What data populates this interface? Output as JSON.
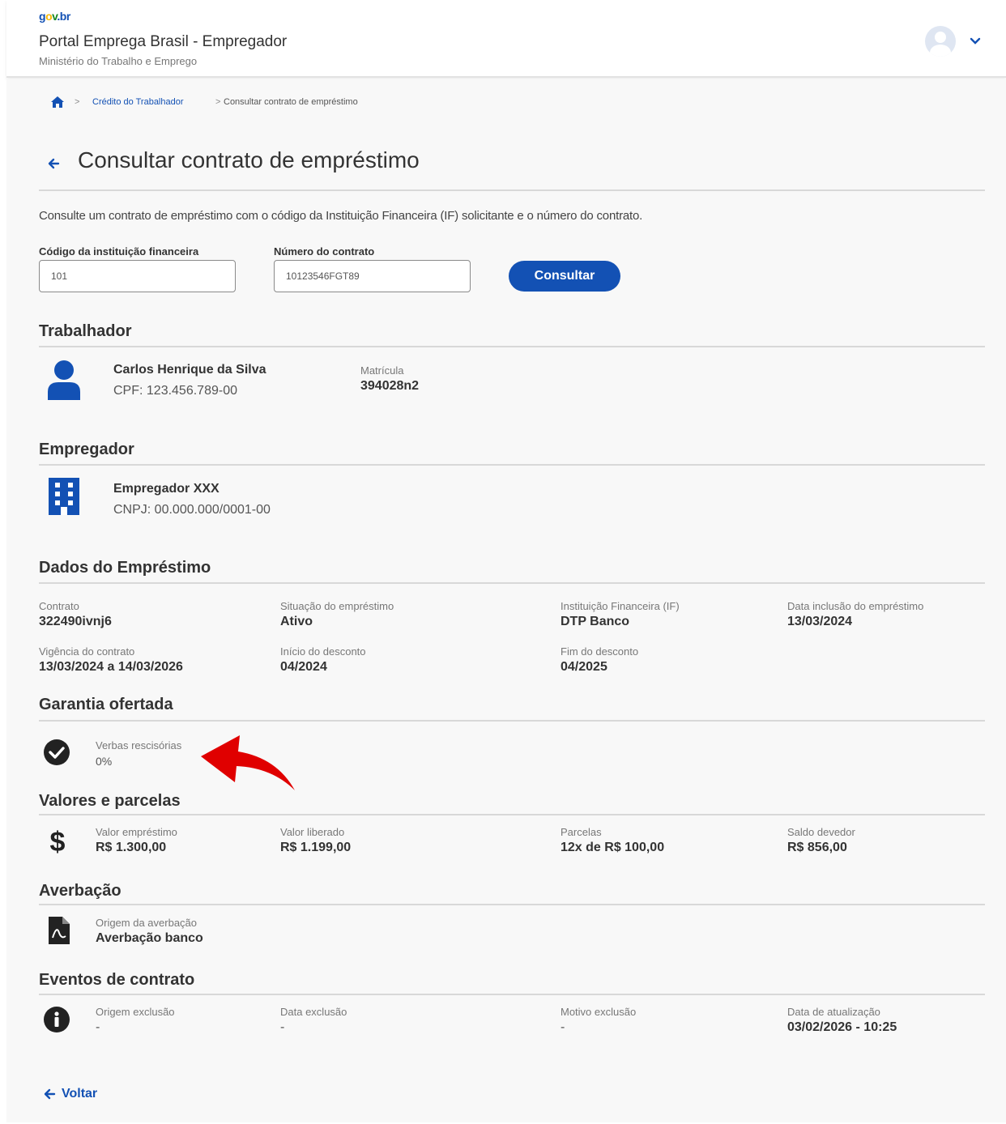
{
  "header": {
    "logo": {
      "g": "g",
      "o": "o",
      "v": "v",
      "br": ".br"
    },
    "title": "Portal Emprega Brasil - Empregador",
    "subtitle": "Ministério do Trabalho e Emprego"
  },
  "breadcrumb": {
    "sep": ">",
    "link": "Crédito do Trabalhador",
    "current": "Consultar contrato de empréstimo"
  },
  "page": {
    "title": "Consultar contrato de empréstimo",
    "description": "Consulte um contrato de empréstimo com o código da Instituição Financeira (IF) solicitante e o número do contrato."
  },
  "form": {
    "if_label": "Código da instituição financeira",
    "if_value": "101",
    "contract_label": "Número do contrato",
    "contract_value": "10123546FGT89",
    "submit": "Consultar"
  },
  "trabalhador": {
    "heading": "Trabalhador",
    "name": "Carlos Henrique da Silva",
    "cpf": "CPF: 123.456.789-00",
    "matricula_label": "Matrícula",
    "matricula": "394028n2"
  },
  "empregador": {
    "heading": "Empregador",
    "name": "Empregador XXX",
    "cnpj": "CNPJ: 00.000.000/0001-00"
  },
  "emprestimo": {
    "heading": "Dados do Empréstimo",
    "fields": [
      {
        "label": "Contrato",
        "value": "322490ivnj6"
      },
      {
        "label": "Situação do empréstimo",
        "value": "Ativo"
      },
      {
        "label": "Instituição Financeira (IF)",
        "value": "DTP Banco"
      },
      {
        "label": "Data inclusão do empréstimo",
        "value": "13/03/2024"
      },
      {
        "label": "Vigência do contrato",
        "value": "13/03/2024 a 14/03/2026"
      },
      {
        "label": "Início do desconto",
        "value": "04/2024"
      },
      {
        "label": "Fim do desconto",
        "value": "04/2025"
      }
    ]
  },
  "garantia": {
    "heading": "Garantia ofertada",
    "label": "Verbas rescisórias",
    "value": "0%"
  },
  "valores": {
    "heading": "Valores e parcelas",
    "fields": [
      {
        "label": "Valor empréstimo",
        "value": "R$ 1.300,00"
      },
      {
        "label": "Valor liberado",
        "value": "R$ 1.199,00"
      },
      {
        "label": "Parcelas",
        "value": "12x de R$ 100,00"
      },
      {
        "label": "Saldo devedor",
        "value": "R$ 856,00"
      }
    ]
  },
  "averbacao": {
    "heading": "Averbação",
    "label": "Origem da averbação",
    "value": "Averbação banco"
  },
  "eventos": {
    "heading": "Eventos de contrato",
    "fields": [
      {
        "label": "Origem exclusão",
        "value": "-"
      },
      {
        "label": "Data exclusão",
        "value": "-"
      },
      {
        "label": "Motivo exclusão",
        "value": "-"
      },
      {
        "label": "Data de atualização",
        "value": "03/02/2026 - 10:25"
      }
    ]
  },
  "footer": {
    "back": "Voltar"
  },
  "colors": {
    "primary": "#1351b4",
    "annotation": "#e00000"
  }
}
